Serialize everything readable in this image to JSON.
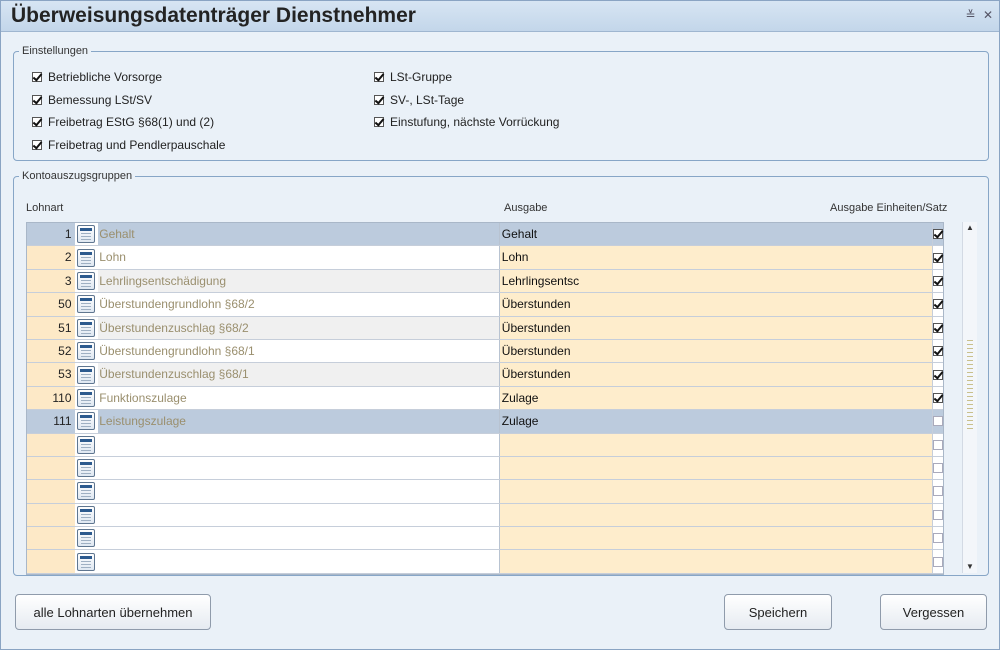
{
  "window": {
    "title": "Überweisungsdatenträger Dienstnehmer",
    "controls": [
      "≚",
      "✕"
    ]
  },
  "settings": {
    "legend": "Einstellungen",
    "left": [
      {
        "label": "Betriebliche Vorsorge",
        "checked": true
      },
      {
        "label": "Bemessung LSt/SV",
        "checked": true
      },
      {
        "label": "Freibetrag EStG §68(1) und (2)",
        "checked": true
      },
      {
        "label": "Freibetrag und Pendlerpauschale",
        "checked": true
      }
    ],
    "right": [
      {
        "label": "LSt-Gruppe",
        "checked": true
      },
      {
        "label": "SV-, LSt-Tage",
        "checked": true
      },
      {
        "label": "Einstufung, nächste Vorrückung",
        "checked": true
      }
    ]
  },
  "groups": {
    "legend": "Kontoauszugsgruppen",
    "columns": {
      "lohnart": "Lohnart",
      "ausgabe": "Ausgabe",
      "einheiten": "Ausgabe Einheiten/Satz"
    },
    "rows": [
      {
        "num": "1",
        "name": "Gehalt",
        "out": "Gehalt",
        "checked": true
      },
      {
        "num": "2",
        "name": "Lohn",
        "out": "Lohn",
        "checked": true
      },
      {
        "num": "3",
        "name": "Lehrlingsentschädigung",
        "out": "Lehrlingsentsc",
        "checked": true
      },
      {
        "num": "50",
        "name": "Überstundengrundlohn §68/2",
        "out": "Überstunden",
        "checked": true
      },
      {
        "num": "51",
        "name": "Überstundenzuschlag §68/2",
        "out": "Überstunden",
        "checked": true
      },
      {
        "num": "52",
        "name": "Überstundengrundlohn §68/1",
        "out": "Überstunden",
        "checked": true
      },
      {
        "num": "53",
        "name": "Überstundenzuschlag §68/1",
        "out": "Überstunden",
        "checked": true
      },
      {
        "num": "110",
        "name": "Funktionszulage",
        "out": "Zulage",
        "checked": true
      },
      {
        "num": "111",
        "name": "Leistungszulage",
        "out": "Zulage",
        "checked": false
      },
      {
        "num": "",
        "name": "",
        "out": "",
        "checked": false
      },
      {
        "num": "",
        "name": "",
        "out": "",
        "checked": false
      },
      {
        "num": "",
        "name": "",
        "out": "",
        "checked": false
      },
      {
        "num": "",
        "name": "",
        "out": "",
        "checked": false
      },
      {
        "num": "",
        "name": "",
        "out": "",
        "checked": false
      },
      {
        "num": "",
        "name": "",
        "out": "",
        "checked": false
      }
    ],
    "selected_rows": [
      "1",
      "111"
    ]
  },
  "buttons": {
    "take_all": "alle Lohnarten übernehmen",
    "save": "Speichern",
    "forget": "Vergessen"
  }
}
